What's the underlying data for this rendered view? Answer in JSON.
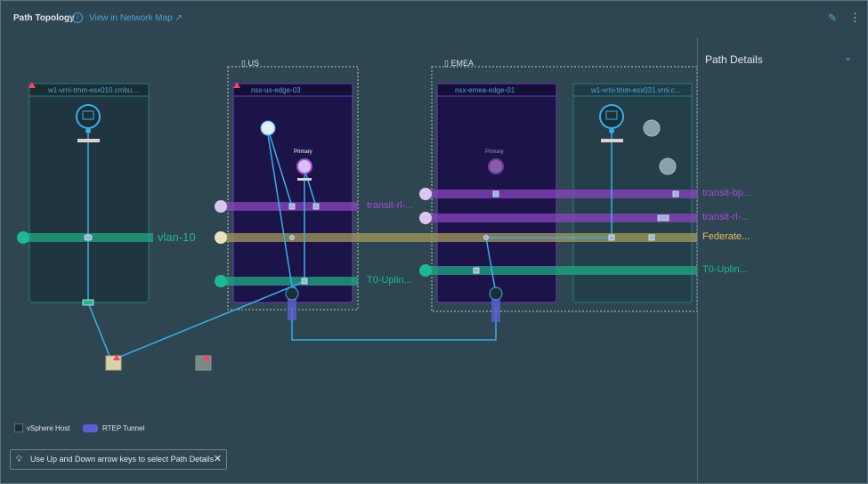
{
  "header": {
    "title": "Path Topology",
    "info_icon": "info-icon",
    "link": "View in Network Map",
    "link_icon": "external-link-icon",
    "pin_icon": "pin-icon",
    "menu_icon": "kebab-menu-icon"
  },
  "panel": {
    "title": "Path Details",
    "chevron": "chevron-down-icon"
  },
  "groups": [
    {
      "label": "US"
    },
    {
      "label": "EMEA"
    }
  ],
  "nodes": [
    {
      "name": "w1-vrni-tmm-esx010.cmbu....",
      "type": "vSphere Host",
      "warning": true
    },
    {
      "name": "nsx-us-edge-03",
      "type": "edge",
      "warning": true,
      "router_label": "Primary"
    },
    {
      "name": "nsx-emea-edge-01",
      "type": "edge",
      "router_label": "Primary"
    },
    {
      "name": "w1-vrni-tmm-esx031.vrni.c...",
      "type": "vSphere Host"
    }
  ],
  "segments": [
    {
      "label": "vlan-10",
      "color": "#1fb894"
    },
    {
      "label": "transit-rl-...",
      "color": "#a44fd6"
    },
    {
      "label": "T0-Uplin...",
      "color": "#1fb894"
    },
    {
      "label": "transit-bp...",
      "color": "#a44fd6"
    },
    {
      "label": "transit-rl-...",
      "color": "#a44fd6"
    },
    {
      "label": "Federate...",
      "color": "#e6c35a"
    },
    {
      "label": "T0-Uplin...",
      "color": "#1fb894"
    }
  ],
  "legend": [
    {
      "label": "vSphere Host",
      "color": "#1b2f37"
    },
    {
      "label": "RTEP Tunnel",
      "color": "#5d5fd1"
    }
  ],
  "hint": {
    "text": "Use Up and Down arrow keys to select Path Details",
    "icon": "lightbulb-icon",
    "close_icon": "close-icon"
  },
  "colors": {
    "background": "#2e4552",
    "accent": "#49a7d6",
    "edge_box": "#1c1448",
    "host_box": "#1f3640"
  }
}
